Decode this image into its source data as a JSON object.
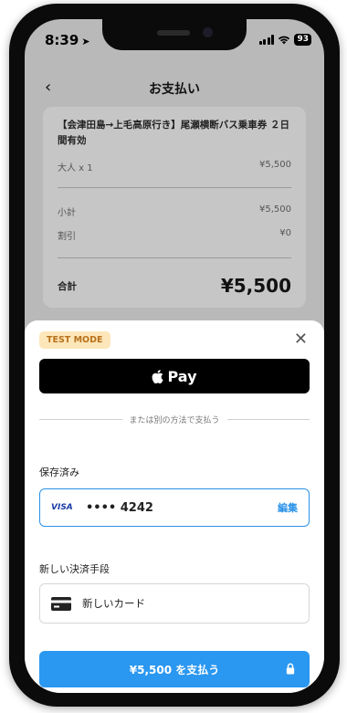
{
  "status_bar": {
    "time": "8:39",
    "battery": "93"
  },
  "header": {
    "title": "お支払い"
  },
  "order": {
    "ticket_name": "【会津田島→上毛高原行き】尾瀬横断バス乗車券 ２日間有効",
    "items": [
      {
        "label": "大人 x 1",
        "price": "¥5,500"
      }
    ],
    "subtotal_label": "小計",
    "subtotal": "¥5,500",
    "discount_label": "割引",
    "discount": "¥0",
    "total_label": "合計",
    "total": "¥5,500"
  },
  "payment_sheet": {
    "test_mode_badge": "TEST MODE",
    "apple_pay_label": "Pay",
    "divider_text": "または別の方法で支払う",
    "saved_label": "保存済み",
    "saved_card": {
      "brand": "VISA",
      "masked_number": "•••• 4242",
      "edit_label": "編集"
    },
    "new_method_label": "新しい決済手段",
    "new_card_label": "新しいカード",
    "pay_button_label": "¥5,500 を支払う"
  },
  "colors": {
    "accent": "#2a97f0",
    "test_mode_bg": "#fde6b9",
    "test_mode_text": "#b7711a"
  }
}
